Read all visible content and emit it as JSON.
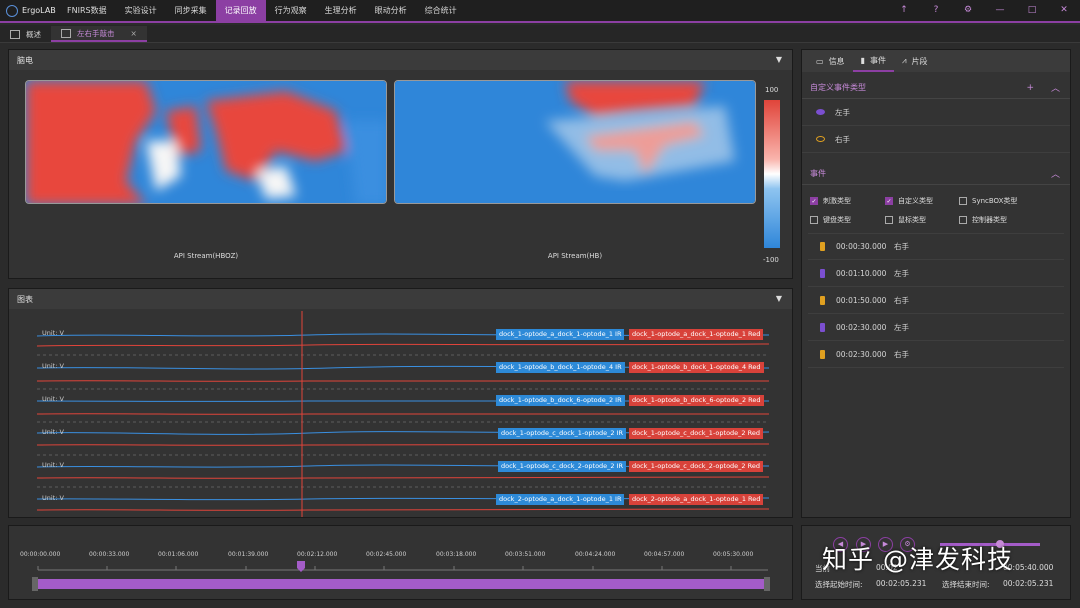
{
  "app": {
    "title": "ErgoLAB"
  },
  "menu": [
    "FNIRS数据",
    "实验设计",
    "同步采集",
    "记录回放",
    "行为观察",
    "生理分析",
    "眼动分析",
    "综合统计"
  ],
  "window_controls": [
    "↑",
    "?",
    "⚙",
    "—",
    "□",
    "✕"
  ],
  "tabs": [
    {
      "label": "概述"
    },
    {
      "label": "左右手敲击",
      "close": "×"
    }
  ],
  "eeg_panel": {
    "title": "脑电",
    "left_label": "API Stream(HBOZ)",
    "right_label": "API Stream(HB)",
    "colorbar_max": "100",
    "colorbar_min": "-100"
  },
  "chart_panel": {
    "title": "图表",
    "rows": [
      {
        "unit": "Unit: V",
        "blue": "dock_1-optode_a_dock_1-optode_1 IR",
        "red": "dock_1-optode_a_dock_1-optode_1 Red"
      },
      {
        "unit": "Unit: V",
        "blue": "dock_1-optode_b_dock_1-optode_4 IR",
        "red": "dock_1-optode_b_dock_1-optode_4 Red"
      },
      {
        "unit": "Unit: V",
        "blue": "dock_1-optode_b_dock_6-optode_2 IR",
        "red": "dock_1-optode_b_dock_6-optode_2 Red"
      },
      {
        "unit": "Unit: V",
        "blue": "dock_1-optode_c_dock_1-optode_2 IR",
        "red": "dock_1-optode_c_dock_1-optode_2 Red"
      },
      {
        "unit": "Unit: V",
        "blue": "dock_1-optode_c_dock_2-optode_2 IR",
        "red": "dock_1-optode_c_dock_2-optode_2 Red"
      },
      {
        "unit": "Unit: V",
        "blue": "dock_2-optode_a_dock_1-optode_1 IR",
        "red": "dock_2-optode_a_dock_1-optode_1 Red"
      }
    ]
  },
  "right_panel": {
    "tabs": [
      "信息",
      "事件",
      "片段"
    ],
    "custom_types_title": "自定义事件类型",
    "custom_types": [
      {
        "label": "左手",
        "color": "#7b4fd0"
      },
      {
        "label": "右手",
        "color": "#e0a020"
      }
    ],
    "events_title": "事件",
    "filters": [
      {
        "label": "刺激类型",
        "checked": true
      },
      {
        "label": "自定义类型",
        "checked": true
      },
      {
        "label": "SyncBOX类型",
        "checked": false
      },
      {
        "label": "键盘类型",
        "checked": false
      },
      {
        "label": "鼠标类型",
        "checked": false
      },
      {
        "label": "控制器类型",
        "checked": false
      }
    ],
    "events": [
      {
        "time": "00:00:30.000",
        "label": "右手"
      },
      {
        "time": "00:01:10.000",
        "label": "左手"
      },
      {
        "time": "00:01:50.000",
        "label": "右手"
      },
      {
        "time": "00:02:30.000",
        "label": "左手"
      },
      {
        "time": "00:02:30.000",
        "label": "右手"
      }
    ]
  },
  "timeline": {
    "ticks": [
      "00:00:00.000",
      "00:00:33.000",
      "00:01:06.000",
      "00:01:39.000",
      "00:02:12.000",
      "00:02:45.000",
      "00:03:18.000",
      "00:03:51.000",
      "00:04:24.000",
      "00:04:57.000",
      "00:05:30.000"
    ],
    "cursor": "00:02:12.000"
  },
  "playback": {
    "current_label": "当前",
    "current_value": "00:02",
    "total_value": "00:05:40.000",
    "sel_start_label": "选择起始时间:",
    "sel_start_value": "00:02:05.231",
    "sel_end_label": "选择结束时间:",
    "sel_end_value": "00:02:05.231"
  },
  "watermark": "知乎 @津发科技"
}
